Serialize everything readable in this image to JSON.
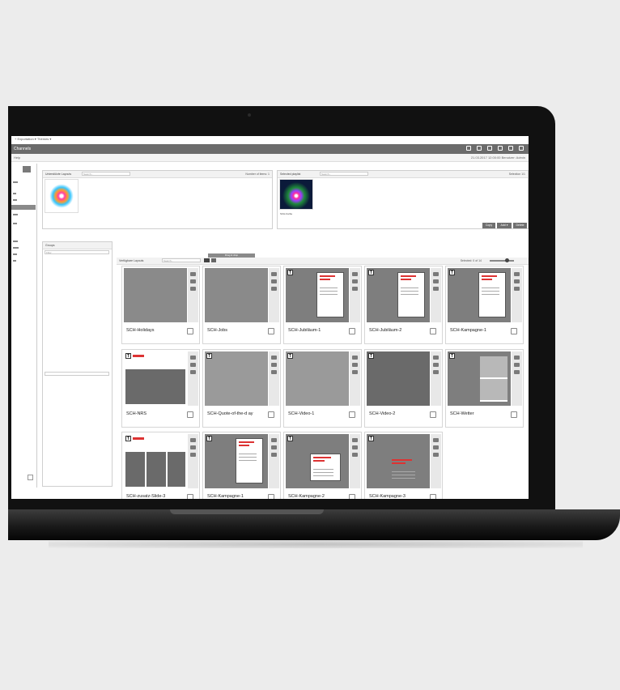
{
  "menu": {
    "text": "+  Exportation ▾   Thèmes ▾"
  },
  "window": {
    "title": "Channels",
    "status_left": "Help",
    "status_right": "21.03.2017  12:00:00  Benutzer: Admin"
  },
  "sidebar": {
    "items": [
      "a",
      "b",
      "c",
      "d",
      "e",
      "f"
    ]
  },
  "panels": {
    "left_top": {
      "title": "Unterstützte Layouts",
      "search": "Search...",
      "count": "Number of items: 1"
    },
    "right_top": {
      "title": "Selected playlist",
      "search": "Search...",
      "right": "Selection 1/1"
    },
    "right_top_item": "SCH-Farbe",
    "buttons": [
      "Copy",
      "Add ▾",
      "Delete"
    ],
    "groups": {
      "title": "Groups",
      "filter": "Filter"
    },
    "grid": {
      "title": "Verfügbare Layouts",
      "search": "Search...",
      "right": "Selected: 0 of 14",
      "tag": "Drag & drop"
    }
  },
  "cards": [
    {
      "label": "SCH-Holidays",
      "kind": "splash"
    },
    {
      "label": "SCH-Jobs",
      "kind": "splash2"
    },
    {
      "label": "SCH-Jubiläum-1",
      "kind": "doc"
    },
    {
      "label": "SCH-Jubiläum-2",
      "kind": "doc"
    },
    {
      "label": "SCH-Kampagne-1",
      "kind": "doc"
    },
    {
      "label": "SCH-NRS",
      "kind": "news"
    },
    {
      "label": "SCH-Quote-of-the-d ay",
      "kind": "grey"
    },
    {
      "label": "SCH-Video-1",
      "kind": "grey"
    },
    {
      "label": "SCH-Video-2",
      "kind": "dark"
    },
    {
      "label": "SCH-Wetter",
      "kind": "weather"
    },
    {
      "label": "SCH-zusatz-Slide-3",
      "kind": "cols"
    },
    {
      "label": "SCH-Kampagne-1",
      "kind": "doc"
    },
    {
      "label": "SCH-Kampagne-2",
      "kind": "doc2"
    },
    {
      "label": "SCH-Kampagne-3",
      "kind": "doc3"
    }
  ]
}
